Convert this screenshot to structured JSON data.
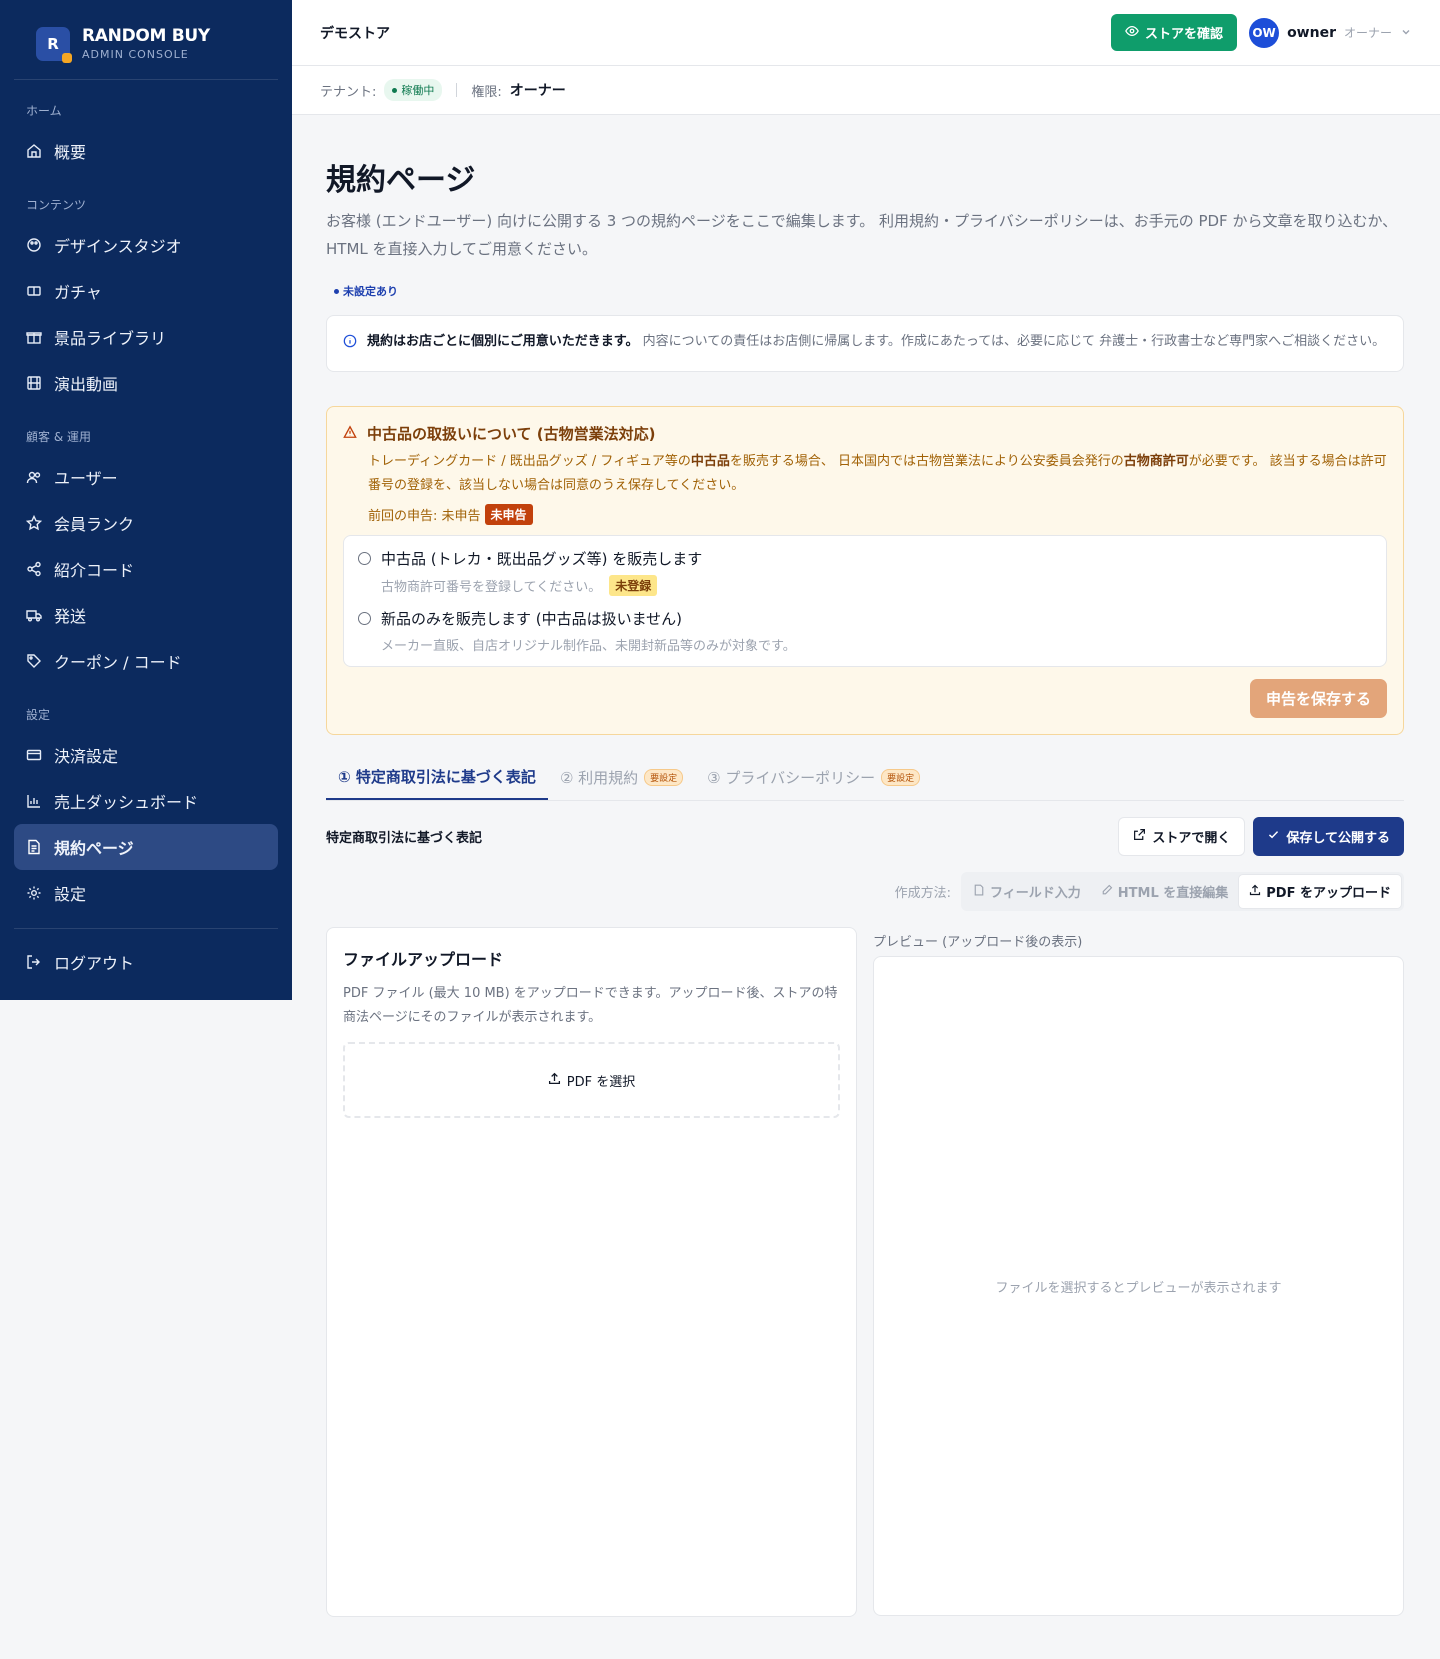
{
  "brand": {
    "initial": "R",
    "name": "RANDOM BUY",
    "sub": "ADMIN CONSOLE"
  },
  "sidebar": {
    "groups": [
      {
        "heading": "ホーム",
        "items": [
          {
            "label": "概要",
            "icon": "home-icon"
          }
        ]
      },
      {
        "heading": "コンテンツ",
        "items": [
          {
            "label": "デザインスタジオ",
            "icon": "palette-icon"
          },
          {
            "label": "ガチャ",
            "icon": "ticket-icon"
          },
          {
            "label": "景品ライブラリ",
            "icon": "gift-icon"
          },
          {
            "label": "演出動画",
            "icon": "film-icon"
          }
        ]
      },
      {
        "heading": "顧客 & 運用",
        "items": [
          {
            "label": "ユーザー",
            "icon": "users-icon"
          },
          {
            "label": "会員ランク",
            "icon": "star-icon"
          },
          {
            "label": "紹介コード",
            "icon": "share-icon"
          },
          {
            "label": "発送",
            "icon": "truck-icon"
          },
          {
            "label": "クーポン / コード",
            "icon": "tag-icon"
          }
        ]
      },
      {
        "heading": "設定",
        "items": [
          {
            "label": "決済設定",
            "icon": "card-icon"
          },
          {
            "label": "売上ダッシュボード",
            "icon": "chart-icon"
          },
          {
            "label": "規約ページ",
            "icon": "document-icon",
            "active": true
          },
          {
            "label": "設定",
            "icon": "gear-icon"
          }
        ]
      }
    ],
    "logout": "ログアウト"
  },
  "header": {
    "store_name": "デモストア",
    "view_store": "ストアを確認",
    "avatar": "OW",
    "user": "owner",
    "role": "オーナー"
  },
  "subbar": {
    "tenant_label": "テナント:",
    "tenant_status": "稼働中",
    "permission_label": "権限:",
    "permission_value": "オーナー"
  },
  "page": {
    "title": "規約ページ",
    "description": "お客様 (エンドユーザー) 向けに公開する 3 つの規約ページをここで編集します。 利用規約・プライバシーポリシーは、お手元の PDF から文章を取り込むか、HTML を直接入力してご用意ください。",
    "unset_tag": "未設定あり",
    "info_bold": "規約はお店ごとに個別にご用意いただきます。",
    "info_text": "内容についての責任はお店側に帰属します。作成にあたっては、必要に応じて 弁護士・行政書士など専門家へご相談ください。"
  },
  "notice": {
    "title": "中古品の取扱いについて (古物営業法対応)",
    "text_1": "トレーディングカード / 既出品グッズ / フィギュア等の",
    "text_bold_1": "中古品",
    "text_2": "を販売する場合、 日本国内では古物営業法により公安委員会発行の",
    "text_bold_2": "古物商許可",
    "text_3": "が必要です。 該当する場合は許可番号の登録を、該当しない場合は同意のうえ保存してください。",
    "prev_label": "前回の申告: 未申告",
    "prev_badge": "未申告",
    "option_1": "中古品 (トレカ・既出品グッズ等) を販売します",
    "option_1_sub": "古物商許可番号を登録してください。",
    "option_1_badge": "未登録",
    "option_2": "新品のみを販売します (中古品は扱いません)",
    "option_2_sub": "メーカー直販、自店オリジナル制作品、未開封新品等のみが対象です。",
    "save": "申告を保存する"
  },
  "tabs": [
    {
      "label": "① 特定商取引法に基づく表記",
      "active": true,
      "badge": ""
    },
    {
      "label": "② 利用規約",
      "active": false,
      "badge": "要設定"
    },
    {
      "label": "③ プライバシーポリシー",
      "active": false,
      "badge": "要設定"
    }
  ],
  "section": {
    "title": "特定商取引法に基づく表記",
    "open_store": "ストアで開く",
    "save_publish": "保存して公開する",
    "method_label": "作成方法:",
    "method_field": "フィールド入力",
    "method_html": "HTML を直接編集",
    "method_pdf": "PDF をアップロード"
  },
  "upload": {
    "title": "ファイルアップロード",
    "desc": "PDF ファイル (最大 10 MB) をアップロードできます。アップロード後、ストアの特商法ページにそのファイルが表示されます。",
    "select": "PDF を選択"
  },
  "preview": {
    "label": "プレビュー (アップロード後の表示)",
    "empty": "ファイルを選択するとプレビューが表示されます"
  }
}
